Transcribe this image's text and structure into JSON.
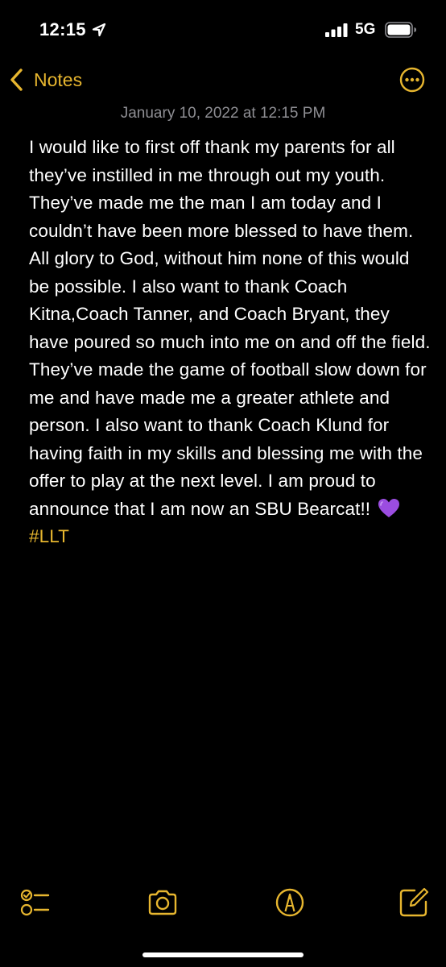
{
  "status_bar": {
    "time": "12:15",
    "network": "5G"
  },
  "nav": {
    "back_label": "Notes"
  },
  "note": {
    "date": "January 10, 2022 at 12:15 PM",
    "body": "I would like to first off thank my parents for all they’ve instilled in me through out my youth. They’ve made me the man I am today and I couldn’t have been more blessed to have them. All glory to God, without him none of this would be possible. I also want to thank Coach Kitna,Coach Tanner, and Coach Bryant, they have poured so much into me on and off the field. They’ve made the game of football slow down for me and have made me a greater athlete and person. I also want to thank Coach Klund for having faith in my skills and blessing me with the offer to play at the next level. I am proud to announce that I am now an SBU Bearcat!!",
    "emoji": "purple-heart",
    "hashtag": "#LLT"
  },
  "toolbar": {
    "icons": [
      "checklist-icon",
      "camera-icon",
      "markup-pen-icon",
      "compose-icon"
    ]
  },
  "colors": {
    "accent": "#e7b62f",
    "background": "#000000",
    "secondary_text": "#8e8e93",
    "emoji_purple": "#9b4de0"
  }
}
